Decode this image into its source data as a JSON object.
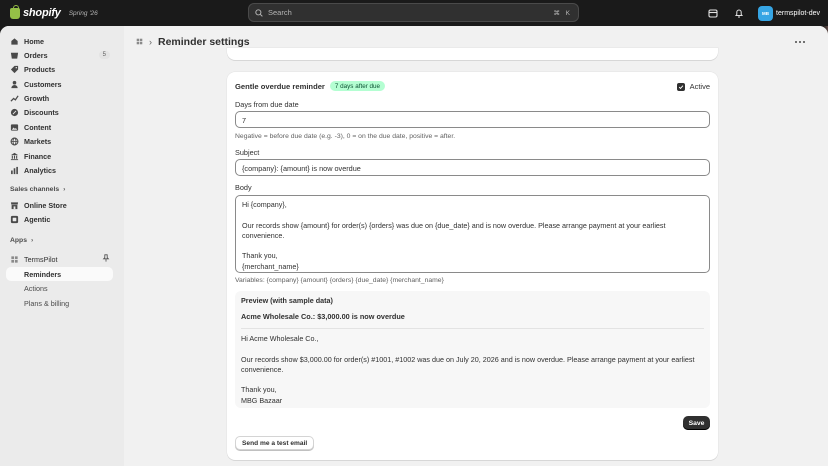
{
  "topbar": {
    "brand": "shopify",
    "edition": "Spring '26",
    "search_placeholder": "Search",
    "search_shortcut": "⌘ K",
    "store_initials": "MB",
    "store_name": "termspilot-dev"
  },
  "sidebar": {
    "items": [
      {
        "label": "Home",
        "icon": "home-icon"
      },
      {
        "label": "Orders",
        "icon": "orders-icon",
        "badge": "5"
      },
      {
        "label": "Products",
        "icon": "products-icon"
      },
      {
        "label": "Customers",
        "icon": "customers-icon"
      },
      {
        "label": "Growth",
        "icon": "growth-icon"
      },
      {
        "label": "Discounts",
        "icon": "discounts-icon"
      },
      {
        "label": "Content",
        "icon": "content-icon"
      },
      {
        "label": "Markets",
        "icon": "markets-icon"
      },
      {
        "label": "Finance",
        "icon": "finance-icon"
      },
      {
        "label": "Analytics",
        "icon": "analytics-icon"
      }
    ],
    "sales_channels_label": "Sales channels",
    "channels": [
      {
        "label": "Online Store",
        "icon": "online-store-icon"
      },
      {
        "label": "Agentic",
        "icon": "agentic-icon"
      }
    ],
    "apps_label": "Apps",
    "app_name": "TermsPilot",
    "app_subitems": [
      "Reminders",
      "Actions",
      "Plans & billing"
    ]
  },
  "page": {
    "title": "Reminder settings"
  },
  "reminder": {
    "title": "Gentle overdue reminder",
    "pill": "7 days after due",
    "active_label": "Active",
    "active_checked": true,
    "days_label": "Days from due date",
    "days_value": "7",
    "days_help": "Negative = before due date (e.g. -3), 0 = on the due date, positive = after.",
    "subject_label": "Subject",
    "subject_value": "{company}: {amount} is now overdue",
    "body_label": "Body",
    "body_lines": [
      "Hi {company},",
      "",
      "Our records show {amount} for order(s) {orders} was due on {due_date} and is now overdue. Please arrange payment at your earliest",
      "convenience.",
      "",
      "Thank you,",
      "{merchant_name}"
    ],
    "variables_text": "Variables: {company} {amount} {orders} {due_date} {merchant_name}",
    "preview": {
      "title": "Preview (with sample data)",
      "subject": "Acme Wholesale Co.: $3,000.00 is now overdue",
      "body_lines": [
        "Hi Acme Wholesale Co.,",
        "",
        "Our records show $3,000.00 for order(s) #1001, #1002 was due on July 20, 2026 and is now overdue. Please arrange payment at your earliest",
        "convenience.",
        "",
        "Thank you,",
        "MBG Bazaar"
      ]
    },
    "save_label": "Save",
    "test_email_label": "Send me a test email"
  }
}
